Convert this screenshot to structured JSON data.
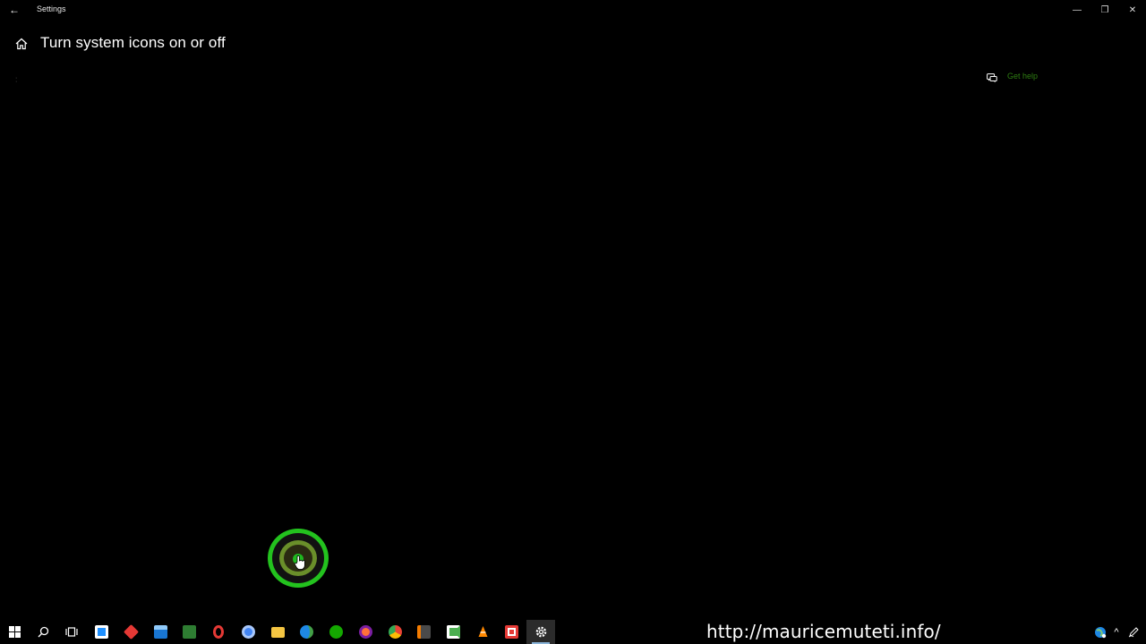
{
  "window": {
    "app_title": "Settings",
    "back_glyph": "←",
    "minimize_glyph": "—",
    "maximize_glyph": "❐",
    "close_glyph": "✕"
  },
  "header": {
    "title": "Turn system icons on or off",
    "home_icon": "home-icon"
  },
  "help": {
    "label": "Get help",
    "icon": "chat-bubble-icon",
    "color": "#2e7d12"
  },
  "overlay": {
    "url": "http://mauricemuteti.info/"
  },
  "taskbar": {
    "items": [
      {
        "name": "start-icon",
        "color": "#ffffff"
      },
      {
        "name": "search-icon",
        "color": "#ffffff"
      },
      {
        "name": "task-view-icon",
        "color": "#ffffff"
      },
      {
        "name": "store-icon",
        "color": "#1e90ff"
      },
      {
        "name": "anydesk-icon",
        "color": "#e53935"
      },
      {
        "name": "mail-icon",
        "color": "#1976d2"
      },
      {
        "name": "chat-app-icon",
        "color": "#2e7d32"
      },
      {
        "name": "opera-icon",
        "color": "#e53935"
      },
      {
        "name": "chromium-icon",
        "color": "#4285f4"
      },
      {
        "name": "file-explorer-icon",
        "color": "#f4c542"
      },
      {
        "name": "edge-icon",
        "color": "#1e88e5"
      },
      {
        "name": "upwork-icon",
        "color": "#14a800"
      },
      {
        "name": "firefox-icon",
        "color": "#ff7139"
      },
      {
        "name": "chrome-icon",
        "color": "#34a853"
      },
      {
        "name": "sublime-text-icon",
        "color": "#f57c00"
      },
      {
        "name": "camtasia-icon",
        "color": "#4caf50"
      },
      {
        "name": "vlc-icon",
        "color": "#ff8800"
      },
      {
        "name": "recorder-icon",
        "color": "#e53935"
      },
      {
        "name": "settings-icon",
        "color": "#ffffff"
      }
    ],
    "tray": {
      "network_icon": "globe-icon",
      "chevron_glyph": "^",
      "pen_icon": "pen-icon"
    }
  }
}
